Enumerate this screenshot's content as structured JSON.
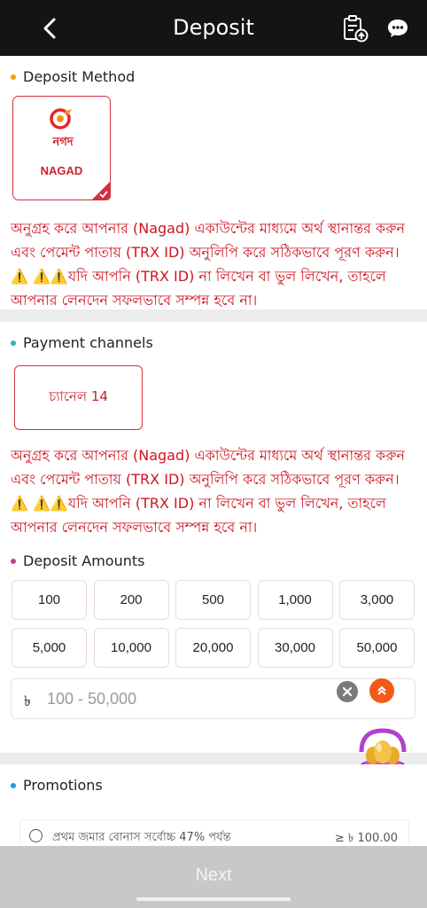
{
  "header": {
    "title": "Deposit",
    "back_icon": "chevron-left-icon",
    "history_icon": "clipboard-upload-icon",
    "support_icon": "chat-bubble-icon"
  },
  "deposit_method": {
    "heading": "Deposit Method",
    "dot_color": "#f0a000",
    "methods": [
      {
        "logo_text": "নগদ",
        "name": "NAGAD",
        "selected": true
      }
    ],
    "notice": "অনুগ্রহ করে আপনার (Nagad) একাউন্টের মাধ্যমে অর্থ স্থানান্তর করুন এবং পেমেন্ট পাতায় (TRX ID) অনুলিপি করে সঠিকভাবে পূরণ করুন। ⚠️ ⚠️⚠️যদি আপনি (TRX ID) না লিখেন বা ভুল লিখেন, তাহলে আপনার লেনদেন সফলভাবে সম্পন্ন হবে না।"
  },
  "payment_channels": {
    "heading": "Payment channels",
    "dot_color": "#2bb6a8",
    "channels": [
      {
        "label": "চ্যানেল 14",
        "selected": true
      }
    ],
    "notice": "অনুগ্রহ করে আপনার (Nagad) একাউন্টের মাধ্যমে অর্থ স্থানান্তর করুন এবং পেমেন্ট পাতায় (TRX ID) অনুলিপি করে সঠিকভাবে পূরণ করুন। ⚠️ ⚠️⚠️যদি আপনি (TRX ID) না লিখেন বা ভুল লিখেন, তাহলে আপনার লেনদেন সফলভাবে সম্পন্ন হবে না।"
  },
  "deposit_amounts": {
    "heading": "Deposit Amounts",
    "dot_color": "#c0408a",
    "amounts": [
      "100",
      "200",
      "500",
      "1,000",
      "3,000",
      "5,000",
      "10,000",
      "20,000",
      "30,000",
      "50,000"
    ],
    "currency_symbol": "৳",
    "input_value": "",
    "input_placeholder": "100 - 50,000"
  },
  "promotions": {
    "heading": "Promotions",
    "dot_color": "#1aa0e0",
    "items": [
      {
        "label": "প্রথম জমার বোনাস সর্বোচ্চ 47% পর্যন্ত",
        "min": "≥ ৳ 100.00"
      }
    ]
  },
  "footer": {
    "next_label": "Next"
  },
  "colors": {
    "header_bg": "#141414",
    "accent_red": "#d01420",
    "footer_bg": "#c8c8c8"
  }
}
